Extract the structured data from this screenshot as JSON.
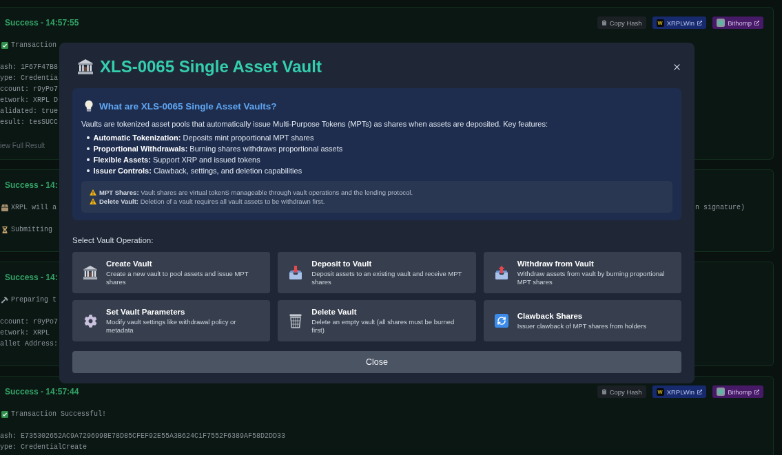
{
  "log_entries": [
    {
      "title": "Success - 14:57:55",
      "actions": [
        {
          "label": "Copy Hash",
          "kind": "copy"
        },
        {
          "label": "XRPLWin",
          "kind": "xrplwin",
          "logo": "W"
        },
        {
          "label": "Bithomp",
          "kind": "bithomp"
        }
      ],
      "blocks": [
        {
          "kind": "success",
          "lines": [
            "Transaction"
          ]
        },
        {
          "kind": "details",
          "lines": [
            "ash: 1F67F47B8",
            "ype: Credentia",
            "ccount: r9yPo7",
            "etwork: XRPL D",
            "alidated: true",
            "esult: tesSUCC"
          ]
        },
        {
          "kind": "link",
          "lines": [
            "iew Full Result"
          ]
        }
      ]
    },
    {
      "title": "Success - 14:",
      "blocks": [
        {
          "kind": "notice",
          "lines": [
            "XRPL will a"
          ],
          "trailing": "n signature)"
        },
        {
          "kind": "pending",
          "lines": [
            "Submitting"
          ]
        }
      ]
    },
    {
      "title": "Success - 14:",
      "blocks": [
        {
          "kind": "preparing",
          "lines": [
            "Preparing t"
          ]
        },
        {
          "kind": "details",
          "lines": [
            "ccount: r9yPo7",
            "etwork: XRPL",
            "allet Address:"
          ]
        }
      ]
    },
    {
      "title": "Success - 14:57:44",
      "actions": [
        {
          "label": "Copy Hash",
          "kind": "copy"
        },
        {
          "label": "XRPLWin",
          "kind": "xrplwin",
          "logo": "W"
        },
        {
          "label": "Bithomp",
          "kind": "bithomp"
        }
      ],
      "blocks": [
        {
          "kind": "success",
          "lines": [
            "Transaction Successful!"
          ]
        },
        {
          "kind": "details",
          "lines": [
            "ash: E735302652AC9A7296998E78D85CFEF92E55A3B624C1F7552F6389AF58D2DD33",
            "ype: CredentialCreate"
          ]
        }
      ]
    }
  ],
  "modal": {
    "title": "XLS-0065 Single Asset Vault",
    "info": {
      "heading": "What are XLS-0065 Single Asset Vaults?",
      "intro": "Vaults are tokenized asset pools that automatically issue Multi-Purpose Tokens (MPTs) as shares when assets are deposited. Key features:",
      "features": [
        "**Automatic Tokenization:** Deposits mint proportional MPT shares",
        "**Proportional Withdrawals:** Burning shares withdraws proportional assets",
        "**Flexible Assets:** Support XRP and issued tokens",
        "**Issuer Controls:** Clawback, settings, and deletion capabilities"
      ],
      "warnings": [
        "**MPT Shares:** Vault shares are virtual tokenS manageable through vault operations and the lending protocol.",
        "**Delete Vault:** Deletion of a vault requires all vault assets to be withdrawn first."
      ]
    },
    "operations_label": "Select Vault Operation:",
    "operations": [
      {
        "title": "Create Vault",
        "description": "Create a new vault to pool assets and issue MPT shares"
      },
      {
        "title": "Deposit to Vault",
        "description": "Deposit assets to an existing vault and receive MPT shares"
      },
      {
        "title": "Withdraw from Vault",
        "description": "Withdraw assets from vault by burning proportional MPT shares"
      },
      {
        "title": "Set Vault Parameters",
        "description": "Modify vault settings like withdrawal policy or metadata"
      },
      {
        "title": "Delete Vault",
        "description": "Delete an empty vault (all shares must be burned first)"
      },
      {
        "title": "Clawback Shares",
        "description": "Issuer clawback of MPT shares from holders"
      }
    ],
    "close_label": "Close"
  }
}
